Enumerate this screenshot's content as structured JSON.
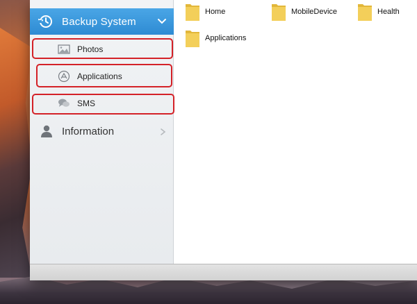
{
  "sidebar": {
    "section": {
      "label": "Backup System",
      "icon": "history-clock-icon",
      "expanded": true
    },
    "items": [
      {
        "label": "Photos",
        "icon": "image-icon",
        "highlighted": true
      },
      {
        "label": "Applications",
        "icon": "app-store-icon",
        "highlighted": true
      },
      {
        "label": "SMS",
        "icon": "chat-bubble-icon",
        "highlighted": true
      }
    ],
    "info": {
      "label": "Information",
      "icon": "person-icon"
    }
  },
  "content": {
    "folders": [
      {
        "name": "Home"
      },
      {
        "name": "MobileDevice"
      },
      {
        "name": "Health"
      },
      {
        "name": "Applications"
      }
    ]
  },
  "colors": {
    "accent": "#2e8bd3",
    "highlight": "#d42127",
    "folder": "#f2c94c"
  }
}
